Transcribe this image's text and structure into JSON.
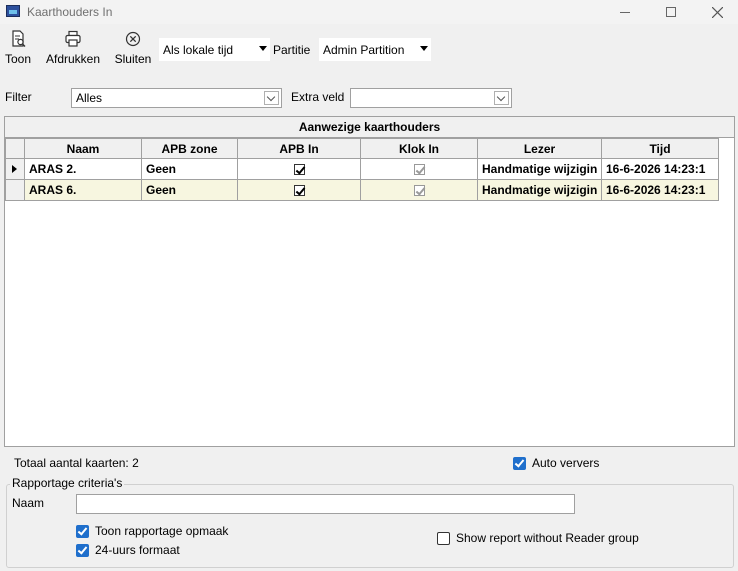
{
  "window": {
    "title": "Kaarthouders In"
  },
  "toolbar": {
    "toon": "Toon",
    "print": "Afdrukken",
    "close": "Sluiten",
    "timezone": "Als lokale tijd",
    "partition_label": "Partitie",
    "partition": "Admin Partition"
  },
  "filter": {
    "label": "Filter",
    "value": "Alles",
    "extra_label": "Extra veld",
    "extra_value": ""
  },
  "grid": {
    "caption": "Aanwezige kaarthouders",
    "columns": [
      "Naam",
      "APB zone",
      "APB In",
      "Klok In",
      "Lezer",
      "Tijd"
    ],
    "rows": [
      {
        "naam": "ARAS 2.",
        "zone": "Geen",
        "apb_in": true,
        "klok_in": true,
        "lezer": "Handmatige wijzigin",
        "tijd": "16-6-2026 14:23:1"
      },
      {
        "naam": "ARAS 6.",
        "zone": "Geen",
        "apb_in": true,
        "klok_in": true,
        "lezer": "Handmatige wijzigin",
        "tijd": "16-6-2026 14:23:1"
      }
    ]
  },
  "footer": {
    "total": "Totaal aantal kaarten: 2",
    "auto_refresh": "Auto ververs",
    "criteria_title": "Rapportage criteria's",
    "naam_label": "Naam",
    "naam_value": "",
    "show_format": "Toon rapportage opmaak",
    "format_24h": "24-uurs formaat",
    "no_reader_group": "Show report without Reader group"
  }
}
